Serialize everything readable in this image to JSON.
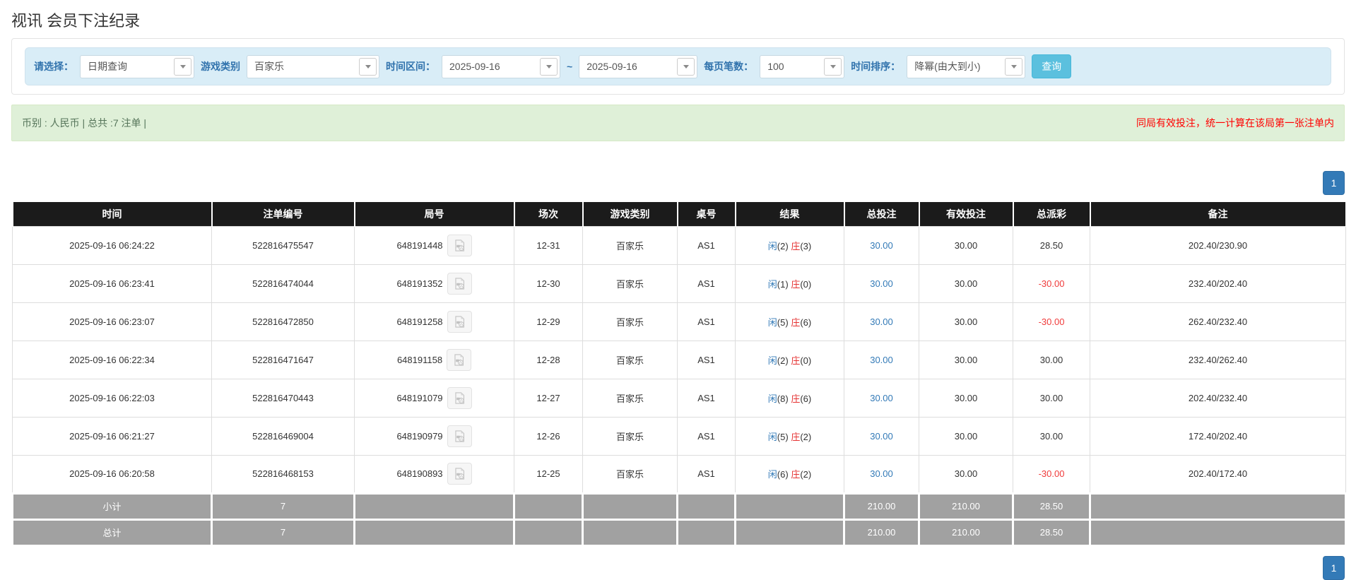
{
  "page": {
    "title": "视讯 会员下注纪录"
  },
  "colors": {
    "accent_blue": "#337ab7",
    "filter_bg": "#d9edf7",
    "alert_bg": "#dff0d8",
    "header_bg": "#1b1b1b",
    "footer_bg": "#a1a1a1",
    "search_button_bg": "#5bc0de",
    "negative_red": "#f03b3b",
    "banker_red": "#e53333",
    "notice_red": "#ff0000"
  },
  "filters": {
    "select_label": "请选择：",
    "select_value": "日期查询",
    "game_type_label": "游戏类别",
    "game_type_value": "百家乐",
    "time_range_label": "时间区间：",
    "date_from": "2025-09-16",
    "tilde": "~",
    "date_to": "2025-09-16",
    "page_size_label": "每页笔数：",
    "page_size_value": "100",
    "sort_label": "时间排序：",
    "sort_value": "降幂(由大到小)",
    "search_button": "查询"
  },
  "summary": {
    "left_text": "币别 : 人民币 | 总共 :7 注单 |",
    "right_text": "同局有效投注，统一计算在该局第一张注单内"
  },
  "pagination": {
    "page": "1"
  },
  "icons": {
    "dropdown": "chevron-down-icon",
    "round_video": "video-file-icon"
  },
  "table": {
    "headers": [
      "时间",
      "注单编号",
      "局号",
      "场次",
      "游戏类别",
      "桌号",
      "结果",
      "总投注",
      "有效投注",
      "总派彩",
      "备注"
    ],
    "rows": [
      {
        "time": "2025-09-16 06:24:22",
        "bet_id": "522816475547",
        "round_id": "648191448",
        "session": "12-31",
        "game": "百家乐",
        "table_no": "AS1",
        "player": "闲",
        "player_n": "(2)",
        "banker": "庄",
        "banker_n": "(3)",
        "total_bet": "30.00",
        "valid_bet": "30.00",
        "payout": "28.50",
        "remark": "202.40/230.90"
      },
      {
        "time": "2025-09-16 06:23:41",
        "bet_id": "522816474044",
        "round_id": "648191352",
        "session": "12-30",
        "game": "百家乐",
        "table_no": "AS1",
        "player": "闲",
        "player_n": "(1)",
        "banker": "庄",
        "banker_n": "(0)",
        "total_bet": "30.00",
        "valid_bet": "30.00",
        "payout": "-30.00",
        "remark": "232.40/202.40"
      },
      {
        "time": "2025-09-16 06:23:07",
        "bet_id": "522816472850",
        "round_id": "648191258",
        "session": "12-29",
        "game": "百家乐",
        "table_no": "AS1",
        "player": "闲",
        "player_n": "(5)",
        "banker": "庄",
        "banker_n": "(6)",
        "total_bet": "30.00",
        "valid_bet": "30.00",
        "payout": "-30.00",
        "remark": "262.40/232.40"
      },
      {
        "time": "2025-09-16 06:22:34",
        "bet_id": "522816471647",
        "round_id": "648191158",
        "session": "12-28",
        "game": "百家乐",
        "table_no": "AS1",
        "player": "闲",
        "player_n": "(2)",
        "banker": "庄",
        "banker_n": "(0)",
        "total_bet": "30.00",
        "valid_bet": "30.00",
        "payout": "30.00",
        "remark": "232.40/262.40"
      },
      {
        "time": "2025-09-16 06:22:03",
        "bet_id": "522816470443",
        "round_id": "648191079",
        "session": "12-27",
        "game": "百家乐",
        "table_no": "AS1",
        "player": "闲",
        "player_n": "(8)",
        "banker": "庄",
        "banker_n": "(6)",
        "total_bet": "30.00",
        "valid_bet": "30.00",
        "payout": "30.00",
        "remark": "202.40/232.40"
      },
      {
        "time": "2025-09-16 06:21:27",
        "bet_id": "522816469004",
        "round_id": "648190979",
        "session": "12-26",
        "game": "百家乐",
        "table_no": "AS1",
        "player": "闲",
        "player_n": "(5)",
        "banker": "庄",
        "banker_n": "(2)",
        "total_bet": "30.00",
        "valid_bet": "30.00",
        "payout": "30.00",
        "remark": "172.40/202.40"
      },
      {
        "time": "2025-09-16 06:20:58",
        "bet_id": "522816468153",
        "round_id": "648190893",
        "session": "12-25",
        "game": "百家乐",
        "table_no": "AS1",
        "player": "闲",
        "player_n": "(6)",
        "banker": "庄",
        "banker_n": "(2)",
        "total_bet": "30.00",
        "valid_bet": "30.00",
        "payout": "-30.00",
        "remark": "202.40/172.40"
      }
    ],
    "footer": [
      {
        "label": "小计",
        "count": "7",
        "total_bet": "210.00",
        "valid_bet": "210.00",
        "payout": "28.50"
      },
      {
        "label": "总计",
        "count": "7",
        "total_bet": "210.00",
        "valid_bet": "210.00",
        "payout": "28.50"
      }
    ]
  }
}
